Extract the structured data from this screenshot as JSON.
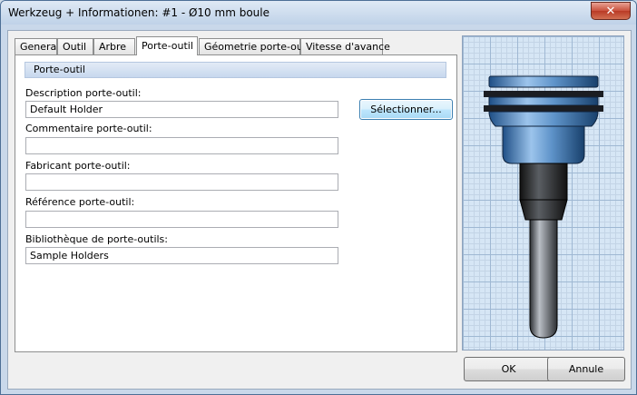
{
  "window": {
    "title": "Werkzeug + Informationen: #1 - Ø10 mm boule",
    "close_glyph": "✕"
  },
  "tabs": [
    {
      "label": "General"
    },
    {
      "label": "Outil"
    },
    {
      "label": "Arbre"
    },
    {
      "label": "Porte-outil",
      "active": true
    },
    {
      "label": "Géometrie porte-outil"
    },
    {
      "label": "Vitesse d'avance"
    }
  ],
  "panel": {
    "section_title": "Porte-outil",
    "description_label": "Description porte-outil:",
    "description_value": "Default Holder",
    "select_button": "Sélectionner...",
    "comment_label": "Commentaire porte-outil:",
    "comment_value": "",
    "manufacturer_label": "Fabricant porte-outil:",
    "manufacturer_value": "",
    "reference_label": "Référence porte-outil:",
    "reference_value": "",
    "library_label": "Bibliothèque de porte-outils:",
    "library_value": "Sample Holders"
  },
  "buttons": {
    "ok": "OK",
    "cancel": "Annule"
  },
  "colors": {
    "holder_blue": "#5e93c9",
    "shaft_dark": "#2e3033",
    "tool_gray": "#8a9099"
  }
}
